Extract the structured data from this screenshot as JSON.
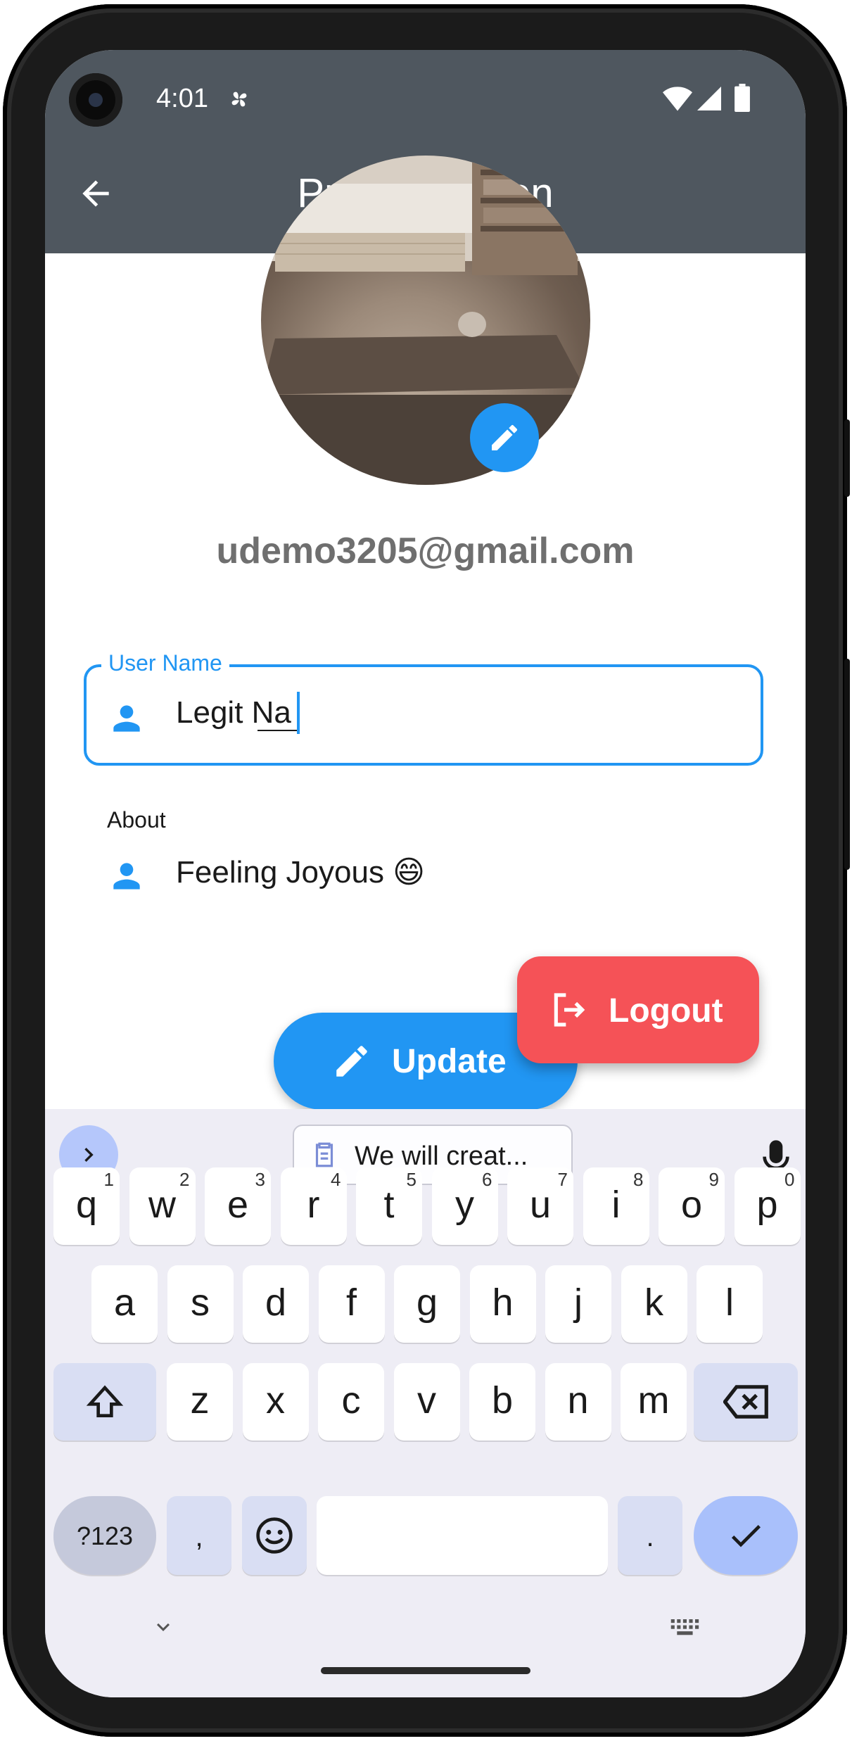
{
  "status_bar": {
    "time": "4:01"
  },
  "app_bar": {
    "title": "Profile Screen"
  },
  "profile": {
    "email": "udemo3205@gmail.com"
  },
  "form": {
    "username_label": "User Name",
    "username_value": "Legit Na",
    "about_label": "About",
    "about_value": "Feeling Joyous 😄"
  },
  "buttons": {
    "update": "Update",
    "logout": "Logout"
  },
  "keyboard": {
    "suggestion": "We will creat...",
    "row1": [
      {
        "k": "q",
        "h": "1"
      },
      {
        "k": "w",
        "h": "2"
      },
      {
        "k": "e",
        "h": "3"
      },
      {
        "k": "r",
        "h": "4"
      },
      {
        "k": "t",
        "h": "5"
      },
      {
        "k": "y",
        "h": "6"
      },
      {
        "k": "u",
        "h": "7"
      },
      {
        "k": "i",
        "h": "8"
      },
      {
        "k": "o",
        "h": "9"
      },
      {
        "k": "p",
        "h": "0"
      }
    ],
    "row2": [
      "a",
      "s",
      "d",
      "f",
      "g",
      "h",
      "j",
      "k",
      "l"
    ],
    "row3": [
      "z",
      "x",
      "c",
      "v",
      "b",
      "n",
      "m"
    ],
    "symbols": "?123",
    "comma": ",",
    "period": "."
  },
  "colors": {
    "primary": "#2196f3",
    "appbar": "#4f575f",
    "logout": "#f55257"
  }
}
